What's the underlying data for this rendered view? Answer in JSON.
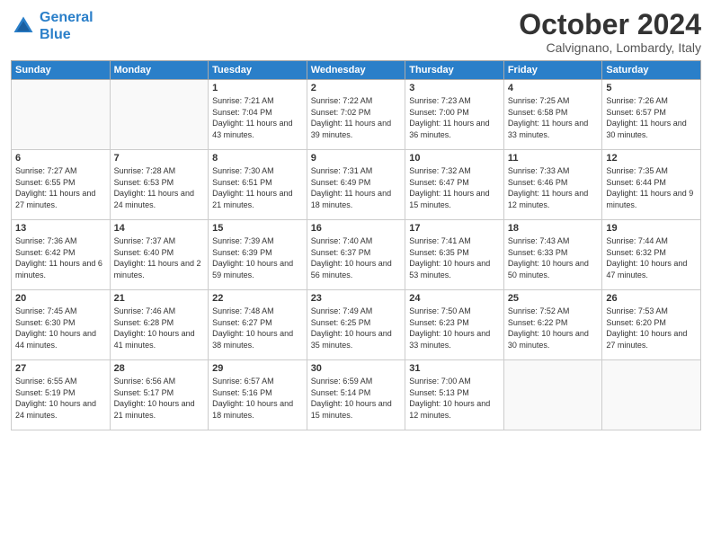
{
  "header": {
    "logo_line1": "General",
    "logo_line2": "Blue",
    "month": "October 2024",
    "location": "Calvignano, Lombardy, Italy"
  },
  "weekdays": [
    "Sunday",
    "Monday",
    "Tuesday",
    "Wednesday",
    "Thursday",
    "Friday",
    "Saturday"
  ],
  "weeks": [
    [
      {
        "day": "",
        "sunrise": "",
        "sunset": "",
        "daylight": "",
        "empty": true
      },
      {
        "day": "",
        "sunrise": "",
        "sunset": "",
        "daylight": "",
        "empty": true
      },
      {
        "day": "1",
        "sunrise": "Sunrise: 7:21 AM",
        "sunset": "Sunset: 7:04 PM",
        "daylight": "Daylight: 11 hours and 43 minutes."
      },
      {
        "day": "2",
        "sunrise": "Sunrise: 7:22 AM",
        "sunset": "Sunset: 7:02 PM",
        "daylight": "Daylight: 11 hours and 39 minutes."
      },
      {
        "day": "3",
        "sunrise": "Sunrise: 7:23 AM",
        "sunset": "Sunset: 7:00 PM",
        "daylight": "Daylight: 11 hours and 36 minutes."
      },
      {
        "day": "4",
        "sunrise": "Sunrise: 7:25 AM",
        "sunset": "Sunset: 6:58 PM",
        "daylight": "Daylight: 11 hours and 33 minutes."
      },
      {
        "day": "5",
        "sunrise": "Sunrise: 7:26 AM",
        "sunset": "Sunset: 6:57 PM",
        "daylight": "Daylight: 11 hours and 30 minutes."
      }
    ],
    [
      {
        "day": "6",
        "sunrise": "Sunrise: 7:27 AM",
        "sunset": "Sunset: 6:55 PM",
        "daylight": "Daylight: 11 hours and 27 minutes."
      },
      {
        "day": "7",
        "sunrise": "Sunrise: 7:28 AM",
        "sunset": "Sunset: 6:53 PM",
        "daylight": "Daylight: 11 hours and 24 minutes."
      },
      {
        "day": "8",
        "sunrise": "Sunrise: 7:30 AM",
        "sunset": "Sunset: 6:51 PM",
        "daylight": "Daylight: 11 hours and 21 minutes."
      },
      {
        "day": "9",
        "sunrise": "Sunrise: 7:31 AM",
        "sunset": "Sunset: 6:49 PM",
        "daylight": "Daylight: 11 hours and 18 minutes."
      },
      {
        "day": "10",
        "sunrise": "Sunrise: 7:32 AM",
        "sunset": "Sunset: 6:47 PM",
        "daylight": "Daylight: 11 hours and 15 minutes."
      },
      {
        "day": "11",
        "sunrise": "Sunrise: 7:33 AM",
        "sunset": "Sunset: 6:46 PM",
        "daylight": "Daylight: 11 hours and 12 minutes."
      },
      {
        "day": "12",
        "sunrise": "Sunrise: 7:35 AM",
        "sunset": "Sunset: 6:44 PM",
        "daylight": "Daylight: 11 hours and 9 minutes."
      }
    ],
    [
      {
        "day": "13",
        "sunrise": "Sunrise: 7:36 AM",
        "sunset": "Sunset: 6:42 PM",
        "daylight": "Daylight: 11 hours and 6 minutes."
      },
      {
        "day": "14",
        "sunrise": "Sunrise: 7:37 AM",
        "sunset": "Sunset: 6:40 PM",
        "daylight": "Daylight: 11 hours and 2 minutes."
      },
      {
        "day": "15",
        "sunrise": "Sunrise: 7:39 AM",
        "sunset": "Sunset: 6:39 PM",
        "daylight": "Daylight: 10 hours and 59 minutes."
      },
      {
        "day": "16",
        "sunrise": "Sunrise: 7:40 AM",
        "sunset": "Sunset: 6:37 PM",
        "daylight": "Daylight: 10 hours and 56 minutes."
      },
      {
        "day": "17",
        "sunrise": "Sunrise: 7:41 AM",
        "sunset": "Sunset: 6:35 PM",
        "daylight": "Daylight: 10 hours and 53 minutes."
      },
      {
        "day": "18",
        "sunrise": "Sunrise: 7:43 AM",
        "sunset": "Sunset: 6:33 PM",
        "daylight": "Daylight: 10 hours and 50 minutes."
      },
      {
        "day": "19",
        "sunrise": "Sunrise: 7:44 AM",
        "sunset": "Sunset: 6:32 PM",
        "daylight": "Daylight: 10 hours and 47 minutes."
      }
    ],
    [
      {
        "day": "20",
        "sunrise": "Sunrise: 7:45 AM",
        "sunset": "Sunset: 6:30 PM",
        "daylight": "Daylight: 10 hours and 44 minutes."
      },
      {
        "day": "21",
        "sunrise": "Sunrise: 7:46 AM",
        "sunset": "Sunset: 6:28 PM",
        "daylight": "Daylight: 10 hours and 41 minutes."
      },
      {
        "day": "22",
        "sunrise": "Sunrise: 7:48 AM",
        "sunset": "Sunset: 6:27 PM",
        "daylight": "Daylight: 10 hours and 38 minutes."
      },
      {
        "day": "23",
        "sunrise": "Sunrise: 7:49 AM",
        "sunset": "Sunset: 6:25 PM",
        "daylight": "Daylight: 10 hours and 35 minutes."
      },
      {
        "day": "24",
        "sunrise": "Sunrise: 7:50 AM",
        "sunset": "Sunset: 6:23 PM",
        "daylight": "Daylight: 10 hours and 33 minutes."
      },
      {
        "day": "25",
        "sunrise": "Sunrise: 7:52 AM",
        "sunset": "Sunset: 6:22 PM",
        "daylight": "Daylight: 10 hours and 30 minutes."
      },
      {
        "day": "26",
        "sunrise": "Sunrise: 7:53 AM",
        "sunset": "Sunset: 6:20 PM",
        "daylight": "Daylight: 10 hours and 27 minutes."
      }
    ],
    [
      {
        "day": "27",
        "sunrise": "Sunrise: 6:55 AM",
        "sunset": "Sunset: 5:19 PM",
        "daylight": "Daylight: 10 hours and 24 minutes."
      },
      {
        "day": "28",
        "sunrise": "Sunrise: 6:56 AM",
        "sunset": "Sunset: 5:17 PM",
        "daylight": "Daylight: 10 hours and 21 minutes."
      },
      {
        "day": "29",
        "sunrise": "Sunrise: 6:57 AM",
        "sunset": "Sunset: 5:16 PM",
        "daylight": "Daylight: 10 hours and 18 minutes."
      },
      {
        "day": "30",
        "sunrise": "Sunrise: 6:59 AM",
        "sunset": "Sunset: 5:14 PM",
        "daylight": "Daylight: 10 hours and 15 minutes."
      },
      {
        "day": "31",
        "sunrise": "Sunrise: 7:00 AM",
        "sunset": "Sunset: 5:13 PM",
        "daylight": "Daylight: 10 hours and 12 minutes."
      },
      {
        "day": "",
        "sunrise": "",
        "sunset": "",
        "daylight": "",
        "empty": true
      },
      {
        "day": "",
        "sunrise": "",
        "sunset": "",
        "daylight": "",
        "empty": true
      }
    ]
  ]
}
